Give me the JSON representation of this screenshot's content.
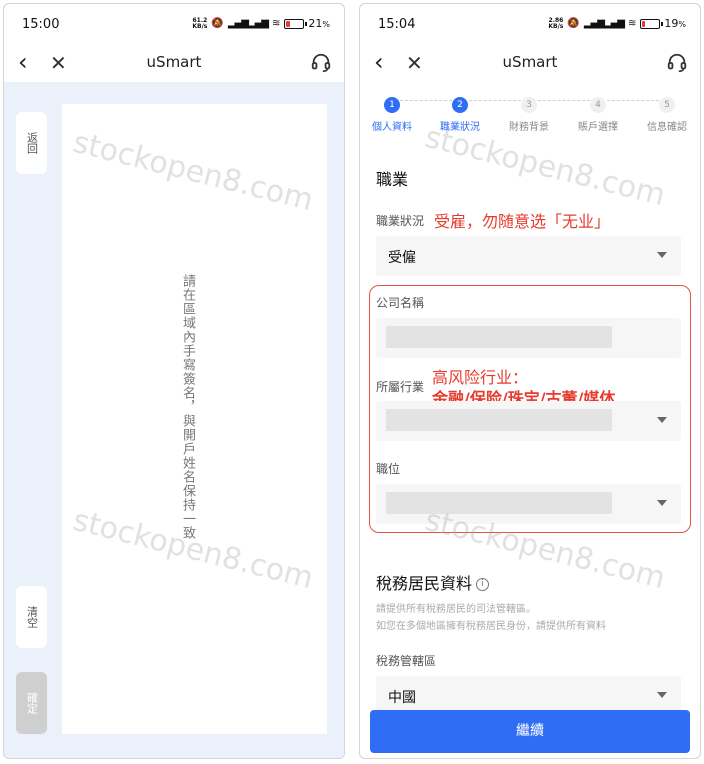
{
  "left": {
    "status": {
      "time": "15:00",
      "speed_top": "61.2",
      "speed_bottom": "KB/s",
      "battery": "21",
      "battery_unit": "%",
      "battery_level": 0.21
    },
    "nav": {
      "title": "uSmart"
    },
    "signature": {
      "back_label": "返回",
      "clear_label": "清空",
      "confirm_label": "確定",
      "hint": "請在區域內手寫簽名，與開戶姓名保持一致"
    },
    "watermark": "stockopen8.com"
  },
  "right": {
    "status": {
      "time": "15:04",
      "speed_top": "2.86",
      "speed_bottom": "KB/s",
      "battery": "19",
      "battery_unit": "%",
      "battery_level": 0.19
    },
    "nav": {
      "title": "uSmart"
    },
    "steps": [
      {
        "num": "1",
        "label": "個人資料",
        "active": true
      },
      {
        "num": "2",
        "label": "職業狀況",
        "active": true
      },
      {
        "num": "3",
        "label": "財務背景",
        "active": false
      },
      {
        "num": "4",
        "label": "賬戶選擇",
        "active": false
      },
      {
        "num": "5",
        "label": "信息確認",
        "active": false
      }
    ],
    "occupation": {
      "title": "職業",
      "status_label": "職業狀況",
      "status_value": "受僱",
      "status_note": "受雇，勿随意选「无业」",
      "company_label": "公司名稱",
      "industry_label": "所屬行業",
      "industry_note_line1": "高风险行业：",
      "industry_note_line2": "金融/保险/珠宝/古董/媒体",
      "position_label": "職位"
    },
    "tax": {
      "title": "稅務居民資料",
      "info_icon": "ⓘ",
      "hint1": "請提供所有稅務居民的司法管轄區。",
      "hint2": "如您在多個地區擁有稅務居民身份，請提供所有資料",
      "jurisdiction_label": "稅務管轄區",
      "jurisdiction_value": "中國"
    },
    "continue_label": "繼續",
    "watermark": "stockopen8.com"
  }
}
